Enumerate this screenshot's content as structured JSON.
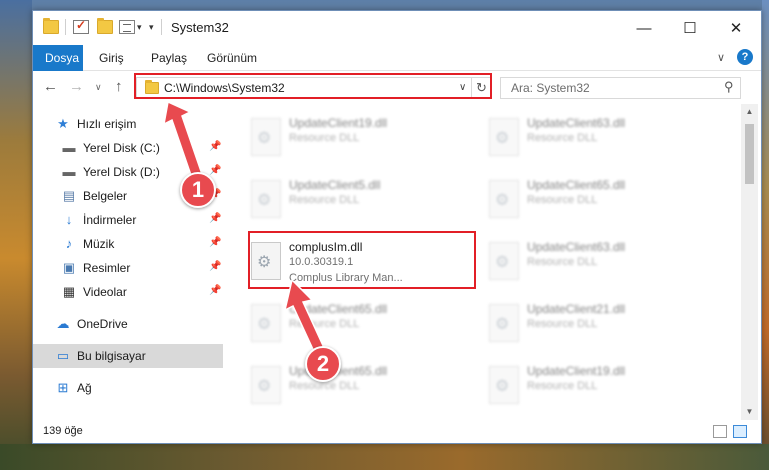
{
  "window": {
    "title": "System32",
    "controls": {
      "minimize": "—",
      "maximize": "☐",
      "close": "✕"
    }
  },
  "ribbon": {
    "tabs": [
      "Dosya",
      "Giriş",
      "Paylaş",
      "Görünüm"
    ],
    "expand": "∨",
    "help": "?"
  },
  "nav": {
    "back": "←",
    "forward": "→",
    "recent": "∨",
    "up": "↑",
    "address": "C:\\Windows\\System32",
    "address_dropdown": "∨",
    "refresh": "↻",
    "search_placeholder": "Ara: System32"
  },
  "sidebar": {
    "items": [
      {
        "label": "Hızlı erişim",
        "icon": "star-icon",
        "pinned": false
      },
      {
        "label": "Yerel Disk (C:)",
        "icon": "drive-icon",
        "pinned": true
      },
      {
        "label": "Yerel Disk (D:)",
        "icon": "drive-icon",
        "pinned": true
      },
      {
        "label": "Belgeler",
        "icon": "documents-icon",
        "pinned": true
      },
      {
        "label": "İndirmeler",
        "icon": "download-icon",
        "pinned": true
      },
      {
        "label": "Müzik",
        "icon": "music-icon",
        "pinned": true
      },
      {
        "label": "Resimler",
        "icon": "pictures-icon",
        "pinned": true
      },
      {
        "label": "Videolar",
        "icon": "video-icon",
        "pinned": true
      },
      {
        "label": "OneDrive",
        "icon": "cloud-icon",
        "pinned": false
      },
      {
        "label": "Bu bilgisayar",
        "icon": "computer-icon",
        "pinned": false,
        "selected": true
      },
      {
        "label": "Ağ",
        "icon": "network-icon",
        "pinned": false
      }
    ]
  },
  "files": [
    {
      "name": "UpdateClient19.dll",
      "desc": "Resource DLL",
      "blurred": true
    },
    {
      "name": "UpdateClient63.dll",
      "desc": "Resource DLL",
      "blurred": true
    },
    {
      "name": "UpdateClient5.dll",
      "desc": "Resource DLL",
      "blurred": true
    },
    {
      "name": "UpdateClient65.dll",
      "desc": "Resource DLL",
      "blurred": true
    },
    {
      "name": "complusIm.dll",
      "version": "10.0.30319.1",
      "desc": "Complus Library Man...",
      "blurred": false,
      "highlighted": true
    },
    {
      "name": "UpdateClient63.dll",
      "desc": "Resource DLL",
      "blurred": true
    },
    {
      "name": "UpdateClient65.dll",
      "desc": "Resource DLL",
      "blurred": true
    },
    {
      "name": "UpdateClient21.dll",
      "desc": "Resource DLL",
      "blurred": true
    },
    {
      "name": "UpdateClient65.dll",
      "desc": "Resource DLL",
      "blurred": true
    },
    {
      "name": "UpdateClient19.dll",
      "desc": "Resource DLL",
      "blurred": true
    }
  ],
  "status": {
    "count": "139 öğe"
  },
  "annotations": {
    "step1": "1",
    "step2": "2"
  },
  "colors": {
    "accent": "#1979ca",
    "highlight_box": "#e21f26",
    "callout": "#e84a4f",
    "selected_bg": "#d9d9d9"
  }
}
